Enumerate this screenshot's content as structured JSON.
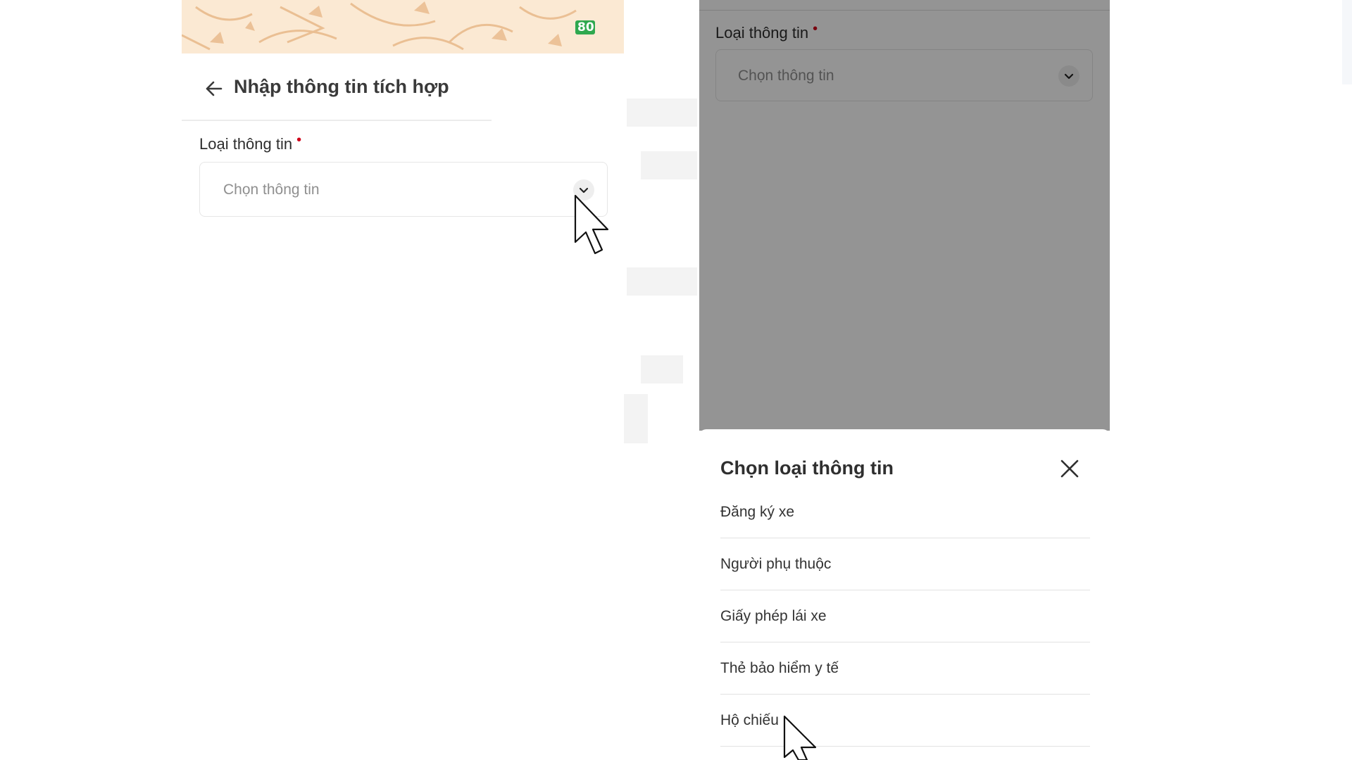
{
  "left_screen": {
    "banner_badge": "80",
    "header": {
      "title": "Nhập thông tin tích hợp"
    },
    "field": {
      "label": "Loại thông tin",
      "placeholder": "Chọn thông tin"
    }
  },
  "right_screen": {
    "field": {
      "label": "Loại thông tin",
      "placeholder": "Chọn thông tin"
    },
    "sheet": {
      "title": "Chọn loại thông tin",
      "options": [
        {
          "label": "Đăng ký xe"
        },
        {
          "label": "Người phụ thuộc"
        },
        {
          "label": "Giấy phép lái xe"
        },
        {
          "label": "Thẻ bảo hiểm y tế"
        },
        {
          "label": "Hộ chiếu"
        }
      ]
    }
  },
  "colors": {
    "required": "#d0021b",
    "banner": "#fbe9d3",
    "badge": "#2fa84f",
    "overlay": "rgba(0,0,0,0.42)"
  },
  "icons": [
    "back-arrow-icon",
    "chevron-down-icon",
    "close-icon",
    "mouse-cursor-icon"
  ]
}
